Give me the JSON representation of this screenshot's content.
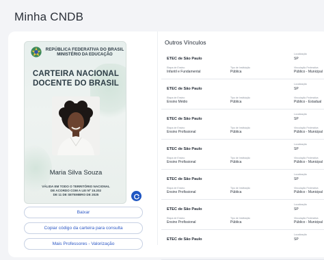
{
  "page": {
    "title": "Minha CNDB"
  },
  "id_card": {
    "republic": "REPÚBLICA FEDERATIVA DO BRASIL",
    "ministry": "MINISTÉRIO DA EDUCAÇÃO",
    "title_line1": "CARTEIRA NACIONAL",
    "title_line2": "DOCENTE DO BRASIL",
    "holder_name": "Maria Silva Souza",
    "validity_line1": "VÁLIDA EM TODO O TERRITÓRIO NACIONAL",
    "validity_line2": "DE ACORDO COM A LEI Nº 15.202",
    "validity_line3": "DE 11 DE SETEMBRO DE 2025"
  },
  "actions": {
    "download_label": "Baixar",
    "copy_label": "Copiar código da carteira para consulta",
    "more_label": "Mais Professores - Valorização"
  },
  "vinculos": {
    "section_title": "Outros Vínculos",
    "labels": {
      "location": "Localização",
      "stage": "Etapa de Ensino",
      "institution_type": "Tipo de Instituição",
      "bond": "Vinculação Federativa"
    },
    "rows": [
      {
        "name": "ETEC de São Paulo",
        "location": "SP",
        "stage": "Infantil e Fundamental",
        "institution_type": "Pública",
        "bond": "Público - Municipal"
      },
      {
        "name": "ETEC de São Paulo",
        "location": "SP",
        "stage": "Ensino Médio",
        "institution_type": "Pública",
        "bond": "Público - Estadual"
      },
      {
        "name": "ETEC de São Paulo",
        "location": "SP",
        "stage": "Ensino Profissional",
        "institution_type": "Pública",
        "bond": "Público - Municipal"
      },
      {
        "name": "ETEC de São Paulo",
        "location": "SP",
        "stage": "Ensino Profissional",
        "institution_type": "Pública",
        "bond": "Público - Municipal"
      },
      {
        "name": "ETEC de São Paulo",
        "location": "SP",
        "stage": "Ensino Profissional",
        "institution_type": "Pública",
        "bond": "Público - Municipal"
      },
      {
        "name": "ETEC de São Paulo",
        "location": "SP",
        "stage": "Ensino Profissional",
        "institution_type": "Pública",
        "bond": "Público - Municipal"
      },
      {
        "name": "ETEC de São Paulo",
        "location": "SP",
        "stage": "",
        "institution_type": "",
        "bond": ""
      }
    ]
  },
  "colors": {
    "accent": "#1f56c2",
    "link": "#2b57c5",
    "background": "#f3f4f7"
  }
}
